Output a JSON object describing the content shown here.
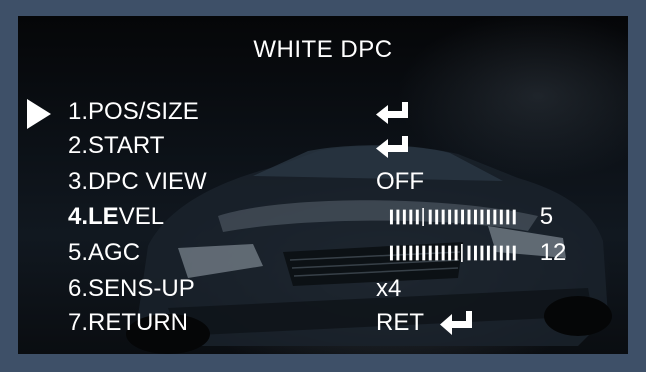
{
  "menu": {
    "title": "WHITE DPC",
    "items": [
      {
        "label": "1.POS/SIZE",
        "value": "",
        "icon": "enter-icon",
        "selected": true
      },
      {
        "label": "2.START",
        "value": "",
        "icon": "enter-icon"
      },
      {
        "label": "3.DPC VIEW",
        "value": "OFF"
      },
      {
        "label_bold": "4.LE",
        "label_rest": "VEL",
        "level": 5,
        "level_text": "5"
      },
      {
        "label": "5.AGC",
        "level": 12,
        "level_text": "12"
      },
      {
        "label": "6.SENS-UP",
        "value": "x4"
      },
      {
        "label": "7.RETURN",
        "value": "RET",
        "icon": "enter-icon"
      }
    ]
  },
  "colors": {
    "border": "#3e5068",
    "text": "#ffffff"
  }
}
